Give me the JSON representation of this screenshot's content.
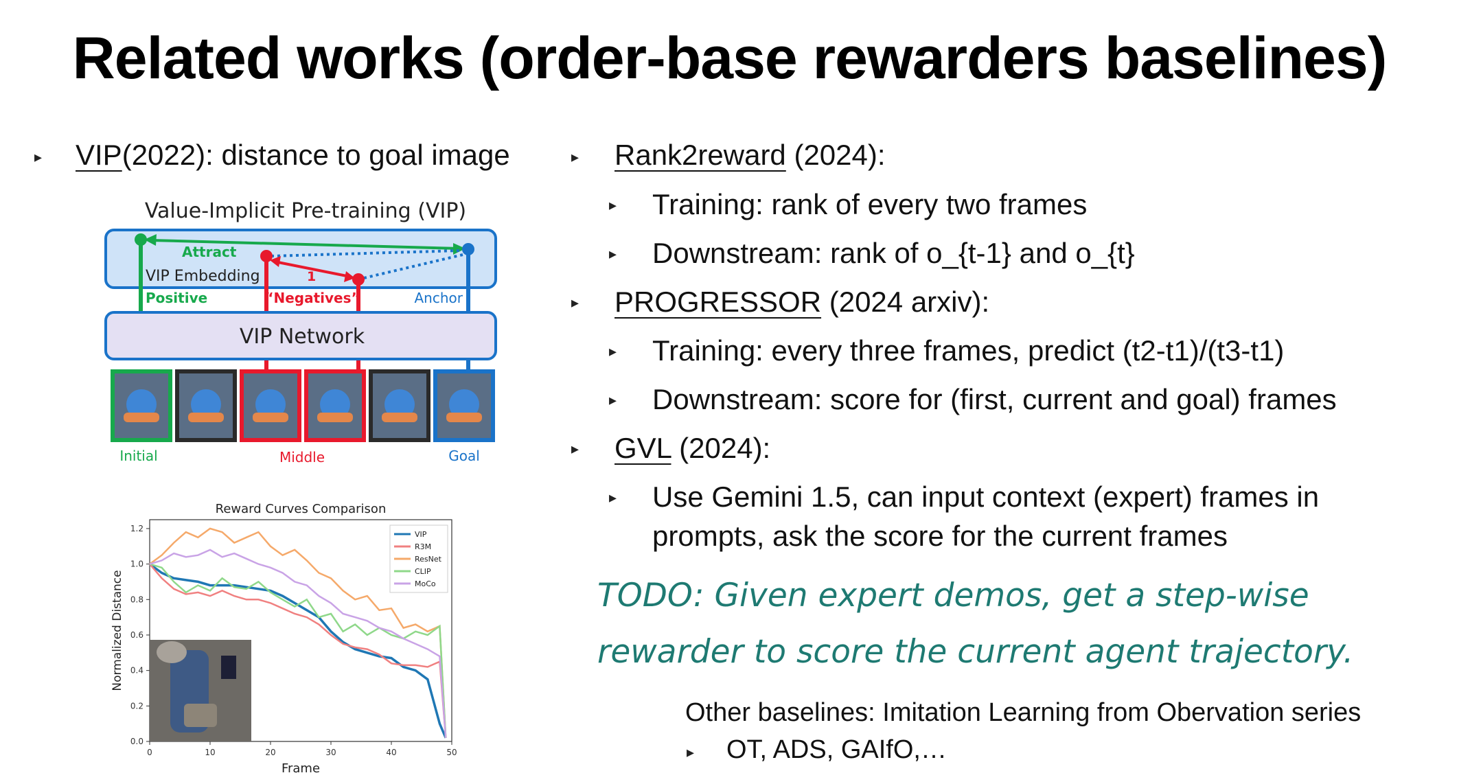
{
  "title": "Related works (order-base rewarders baselines)",
  "left": {
    "vip_name": "VIP",
    "vip_rest": "(2022): distance to goal image",
    "diagram": {
      "title": "Value-Implicit Pre-training (VIP)",
      "attract": "Attract",
      "embedding": "VIP Embedding",
      "one": "1",
      "positive": "Positive",
      "negatives": "“Negatives”",
      "anchor": "Anchor",
      "network": "VIP Network",
      "initial": "Initial",
      "middle": "Middle",
      "goal": "Goal",
      "colors": {
        "green": "#17a94c",
        "red": "#e8192c",
        "blue": "#1a73c9",
        "box": "#cfe3f8",
        "net": "#e4e0f3"
      }
    }
  },
  "right": {
    "items": [
      {
        "name": "Rank2reward",
        "rest": " (2024):",
        "subs": [
          "Training: rank of every two frames",
          "Downstream: rank of o_{t-1} and o_{t}"
        ]
      },
      {
        "name": "PROGRESSOR",
        "rest": " (2024 arxiv):",
        "subs": [
          "Training: every three frames, predict (t2-t1)/(t3-t1)",
          "Downstream: score for (first, current and goal) frames"
        ]
      },
      {
        "name": "GVL",
        "rest": " (2024):",
        "subs": [
          "Use Gemini 1.5, can input context (expert) frames in",
          "prompts, ask the score for the current frames"
        ]
      }
    ],
    "todo_line1": "TODO: Given expert demos, get a step-wise",
    "todo_line2": "rewarder to score the current agent trajectory.",
    "other_title": "Other baselines: Imitation Learning from Obervation series",
    "other_item": "OT, ADS, GAIfO,…"
  },
  "chart_data": {
    "type": "line",
    "title": "Reward Curves Comparison",
    "xlabel": "Frame",
    "ylabel": "Normalized Distance",
    "xlim": [
      0,
      50
    ],
    "ylim": [
      0,
      1.25
    ],
    "xticks": [
      "0",
      "10",
      "20",
      "30",
      "40",
      "50"
    ],
    "yticks": [
      "0.0",
      "0.2",
      "0.4",
      "0.6",
      "0.8",
      "1.0",
      "1.2"
    ],
    "legend_position": "top-right",
    "series": [
      {
        "name": "VIP",
        "color": "#1f77b4",
        "x": [
          0,
          2,
          4,
          6,
          8,
          10,
          12,
          14,
          16,
          18,
          20,
          22,
          24,
          26,
          28,
          30,
          32,
          34,
          36,
          38,
          40,
          42,
          44,
          46,
          48,
          49
        ],
        "y": [
          1.0,
          0.95,
          0.92,
          0.91,
          0.9,
          0.88,
          0.88,
          0.88,
          0.87,
          0.86,
          0.85,
          0.82,
          0.78,
          0.74,
          0.7,
          0.62,
          0.56,
          0.52,
          0.5,
          0.48,
          0.47,
          0.42,
          0.4,
          0.35,
          0.1,
          0.02
        ]
      },
      {
        "name": "R3M",
        "color": "#f08080",
        "x": [
          0,
          2,
          4,
          6,
          8,
          10,
          12,
          14,
          16,
          18,
          20,
          22,
          24,
          26,
          28,
          30,
          32,
          34,
          36,
          38,
          40,
          42,
          44,
          46,
          48,
          49
        ],
        "y": [
          1.0,
          0.92,
          0.86,
          0.83,
          0.84,
          0.82,
          0.85,
          0.82,
          0.8,
          0.8,
          0.78,
          0.75,
          0.72,
          0.7,
          0.66,
          0.6,
          0.55,
          0.53,
          0.52,
          0.49,
          0.44,
          0.43,
          0.43,
          0.42,
          0.45,
          0.02
        ]
      },
      {
        "name": "ResNet",
        "color": "#f5a96a",
        "x": [
          0,
          2,
          4,
          6,
          8,
          10,
          12,
          14,
          16,
          18,
          20,
          22,
          24,
          26,
          28,
          30,
          32,
          34,
          36,
          38,
          40,
          42,
          44,
          46,
          48,
          49
        ],
        "y": [
          1.0,
          1.05,
          1.12,
          1.18,
          1.15,
          1.2,
          1.18,
          1.12,
          1.15,
          1.18,
          1.1,
          1.05,
          1.08,
          1.02,
          0.95,
          0.92,
          0.85,
          0.8,
          0.82,
          0.74,
          0.75,
          0.64,
          0.66,
          0.62,
          0.65,
          0.02
        ]
      },
      {
        "name": "CLIP",
        "color": "#8fd88a",
        "x": [
          0,
          2,
          4,
          6,
          8,
          10,
          12,
          14,
          16,
          18,
          20,
          22,
          24,
          26,
          28,
          30,
          32,
          34,
          36,
          38,
          40,
          42,
          44,
          46,
          48,
          49
        ],
        "y": [
          1.0,
          0.98,
          0.9,
          0.84,
          0.88,
          0.85,
          0.92,
          0.87,
          0.86,
          0.9,
          0.84,
          0.8,
          0.76,
          0.8,
          0.7,
          0.72,
          0.62,
          0.66,
          0.6,
          0.64,
          0.6,
          0.58,
          0.62,
          0.6,
          0.65,
          0.02
        ]
      },
      {
        "name": "MoCo",
        "color": "#c9a3e6",
        "x": [
          0,
          2,
          4,
          6,
          8,
          10,
          12,
          14,
          16,
          18,
          20,
          22,
          24,
          26,
          28,
          30,
          32,
          34,
          36,
          38,
          40,
          42,
          44,
          46,
          48,
          49
        ],
        "y": [
          1.0,
          1.02,
          1.06,
          1.04,
          1.05,
          1.08,
          1.04,
          1.06,
          1.03,
          1.0,
          0.98,
          0.95,
          0.9,
          0.88,
          0.82,
          0.78,
          0.72,
          0.7,
          0.68,
          0.64,
          0.62,
          0.58,
          0.55,
          0.52,
          0.48,
          0.02
        ]
      }
    ]
  }
}
